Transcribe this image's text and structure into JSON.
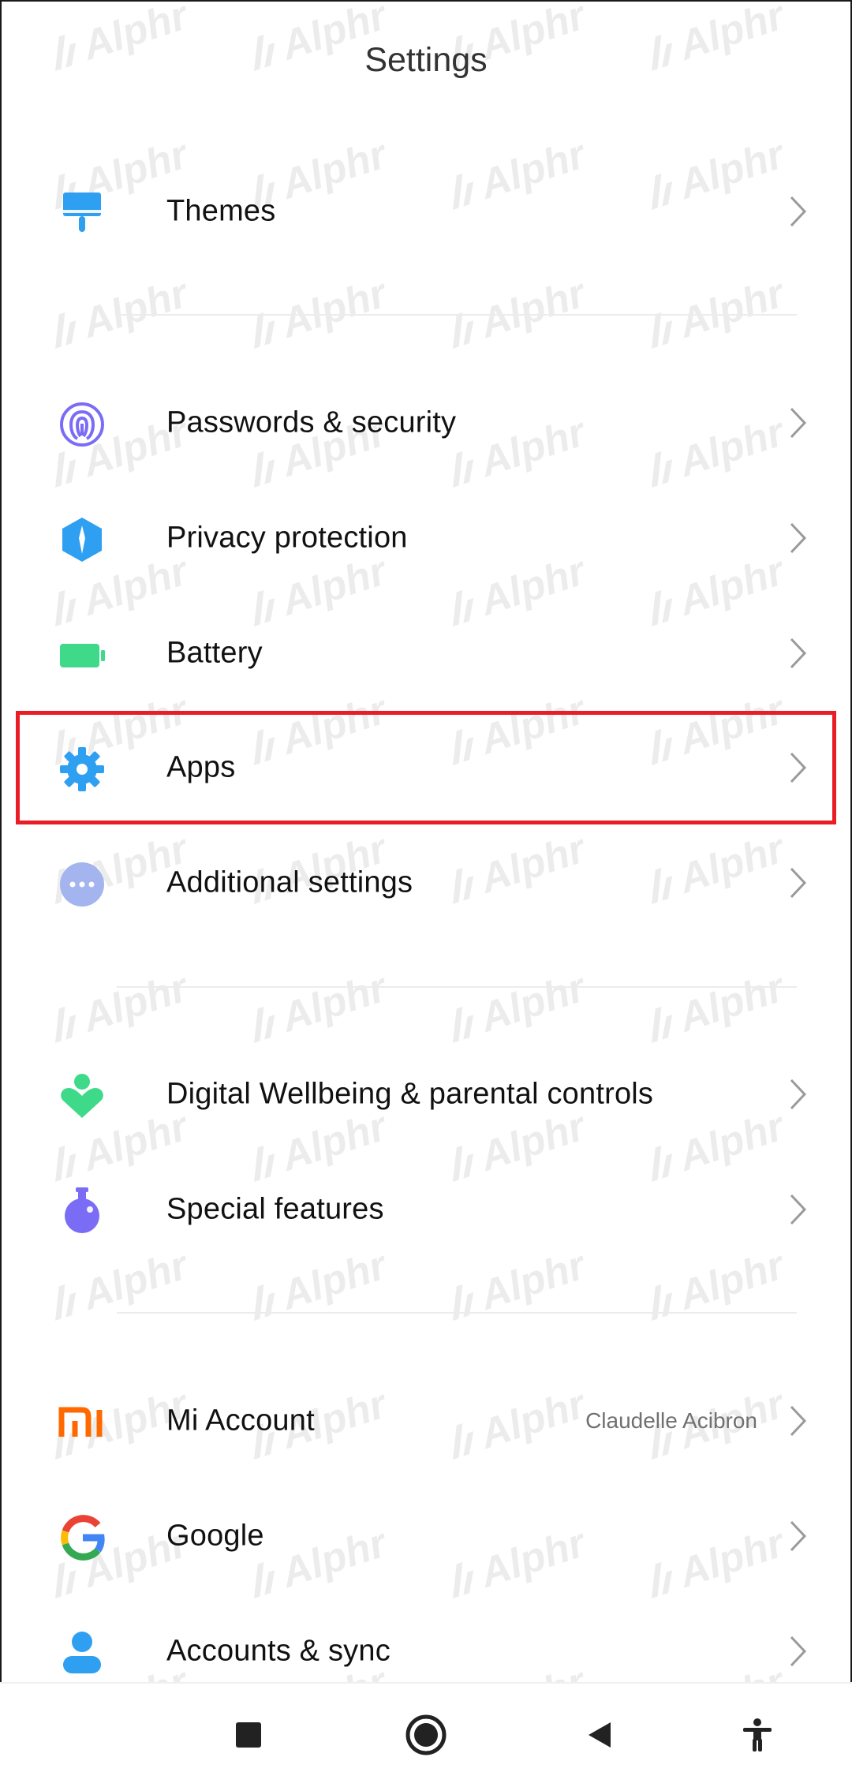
{
  "header": {
    "title": "Settings"
  },
  "items": [
    {
      "name": "themes",
      "label": "Themes",
      "icon": "paint-brush-icon"
    },
    {
      "name": "passwords-security",
      "label": "Passwords & security",
      "icon": "fingerprint-icon"
    },
    {
      "name": "privacy-protection",
      "label": "Privacy protection",
      "icon": "privacy-shield-icon"
    },
    {
      "name": "battery",
      "label": "Battery",
      "icon": "battery-icon"
    },
    {
      "name": "apps",
      "label": "Apps",
      "icon": "gear-icon"
    },
    {
      "name": "additional-settings",
      "label": "Additional settings",
      "icon": "more-dots-icon"
    },
    {
      "name": "digital-wellbeing",
      "label": "Digital Wellbeing & parental controls",
      "icon": "wellbeing-heart-icon"
    },
    {
      "name": "special-features",
      "label": "Special features",
      "icon": "flask-icon"
    },
    {
      "name": "mi-account",
      "label": "Mi Account",
      "value": "Claudelle Acibron",
      "icon": "mi-logo-icon"
    },
    {
      "name": "google",
      "label": "Google",
      "icon": "google-g-icon"
    },
    {
      "name": "accounts-sync",
      "label": "Accounts & sync",
      "icon": "person-icon"
    }
  ],
  "watermark": "Alphr",
  "colors": {
    "highlight": "#ea1d26",
    "icon_blue": "#2f9ff2",
    "icon_purple": "#7b6cf6",
    "icon_green": "#3fd98a",
    "mi_orange": "#ff6900"
  },
  "navbar": {
    "buttons": [
      "recents-square-icon",
      "home-circle-icon",
      "back-triangle-icon",
      "accessibility-icon"
    ]
  }
}
